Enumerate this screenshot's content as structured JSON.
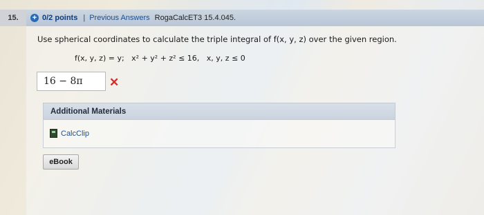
{
  "question": {
    "number": "15.",
    "points": "0/2 points",
    "separator": "|",
    "status_link": "Previous Answers",
    "course_code": "RogaCalcET3 15.4.045.",
    "prompt": "Use spherical coordinates to calculate the triple integral of f(x, y, z) over the given region.",
    "formula": "f(x, y, z) = y;   x² + y² + z² ≤ 16,   x, y, z ≤ 0"
  },
  "answer": {
    "value": "16 − 8π",
    "status_icon": "x-mark-icon",
    "status_color": "#d62b2b"
  },
  "additional_materials": {
    "title": "Additional Materials",
    "items": [
      {
        "label": "CalcClip",
        "icon": "calculator-icon"
      }
    ]
  },
  "ebook_button": {
    "label": "eBook"
  }
}
